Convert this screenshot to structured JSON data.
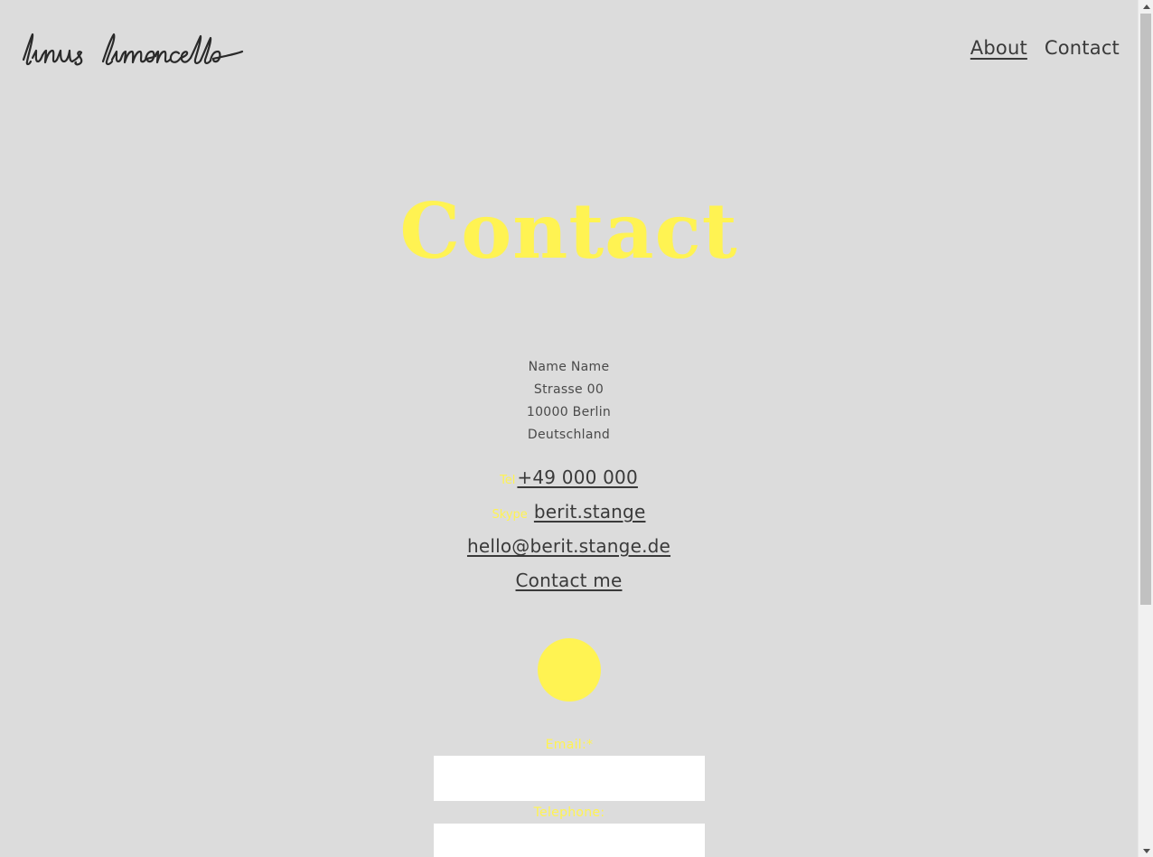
{
  "header": {
    "logo_text": "linus limoncello",
    "nav": [
      {
        "label": "About",
        "active": true
      },
      {
        "label": "Contact",
        "active": false
      }
    ]
  },
  "main": {
    "title": "Contact",
    "address": [
      "Name Name",
      "Strasse 00",
      "10000 Berlin",
      "Deutschland"
    ],
    "tel": {
      "label": "Tel",
      "value": "+49 000 000"
    },
    "skype": {
      "label": "Skype",
      "value": "berit.stange"
    },
    "email": "hello@berit.stange.de",
    "contact_link": "Contact me"
  },
  "form": {
    "email_label": "Email:*",
    "email_value": "",
    "telephone_label": "Telephone:",
    "telephone_value": ""
  },
  "colors": {
    "background": "#dcdcdc",
    "accent": "#fff352",
    "text": "#3a3a3a"
  }
}
